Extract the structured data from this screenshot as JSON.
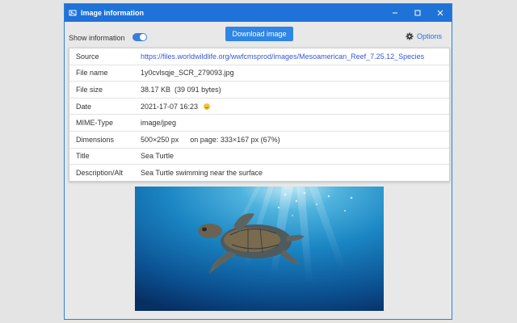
{
  "window": {
    "title": "Image information",
    "controls": [
      "minimize-icon",
      "maximize-icon",
      "close-icon"
    ],
    "accent": "#1f73d8"
  },
  "toolbar": {
    "toggle_label": "Show information",
    "toggle_on": true,
    "download_label": "Download image",
    "options_label": "Options",
    "options_icon": "gear-icon"
  },
  "info": {
    "rows": [
      {
        "key": "Source",
        "value": "https://files.worldwildlife.org/wwfcmsprod/images/Mesoamerican_Reef_7.25.12_Species"
      },
      {
        "key": "File name",
        "value": "1y0cvlsqje_SCR_279093.jpg"
      },
      {
        "key": "File size",
        "value": "38.17 KB",
        "value2": "(39 091 bytes)"
      },
      {
        "key": "Date",
        "value": "2021-17-07 16:23",
        "icon": "smiley-icon"
      },
      {
        "key": "MIME-Type",
        "value": "image/jpeg"
      },
      {
        "key": "Dimensions",
        "value": "500×250 px",
        "value2": "on page: 333×167 px (67%)"
      },
      {
        "key": "Title",
        "value": "Sea Turtle"
      },
      {
        "key": "Description/Alt",
        "value": "Sea Turtle swimming near the surface"
      }
    ]
  },
  "image": {
    "alt": "Sea Turtle swimming near the surface"
  }
}
